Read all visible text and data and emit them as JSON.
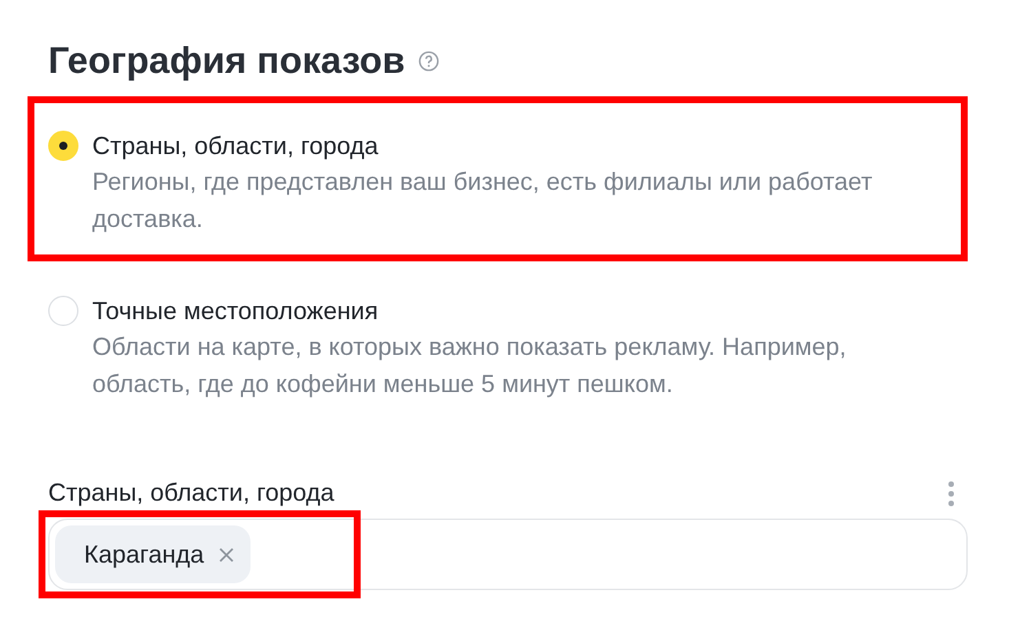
{
  "title": "География показов",
  "options": [
    {
      "label": "Страны, области, города",
      "description": "Регионы, где представлен ваш бизнес, есть филиалы или работает доставка.",
      "selected": true,
      "highlighted": true
    },
    {
      "label": "Точные местоположения",
      "description": "Области на карте, в которых важно показать рекламу. Например, область, где до кофейни меньше 5 минут пешком.",
      "selected": false,
      "highlighted": false
    }
  ],
  "field": {
    "label": "Страны, области, города",
    "tags": [
      {
        "text": "Караганда",
        "highlighted": true
      }
    ]
  }
}
